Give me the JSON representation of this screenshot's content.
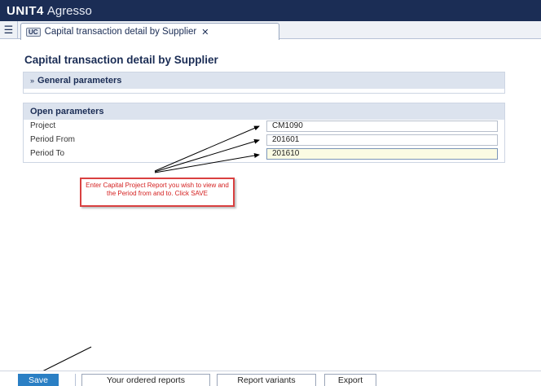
{
  "app": {
    "brand": "UNIT4",
    "product": "Agresso"
  },
  "tabbar": {
    "menu_icon": "list-icon",
    "tab_badge": "UC",
    "tab_label": "Capital transaction detail by Supplier",
    "tab_close": "✕"
  },
  "page": {
    "title": "Capital transaction detail by Supplier"
  },
  "general_panel": {
    "title": "General parameters",
    "chevron": "»"
  },
  "open_panel": {
    "title": "Open parameters",
    "fields": [
      {
        "label": "Project",
        "value": "CM1090"
      },
      {
        "label": "Period From",
        "value": "201601"
      },
      {
        "label": "Period To",
        "value": "201610"
      }
    ]
  },
  "callout": {
    "text": "Enter Capital Project Report you wish to view and the Period from and to. Click SAVE"
  },
  "footer": {
    "save": "Save",
    "ordered": "Your ordered reports",
    "variants": "Report variants",
    "export": "Export"
  },
  "colors": {
    "titlebar": "#1b2d55",
    "primary_button": "#2a7fc4",
    "callout_border": "#d94040"
  }
}
